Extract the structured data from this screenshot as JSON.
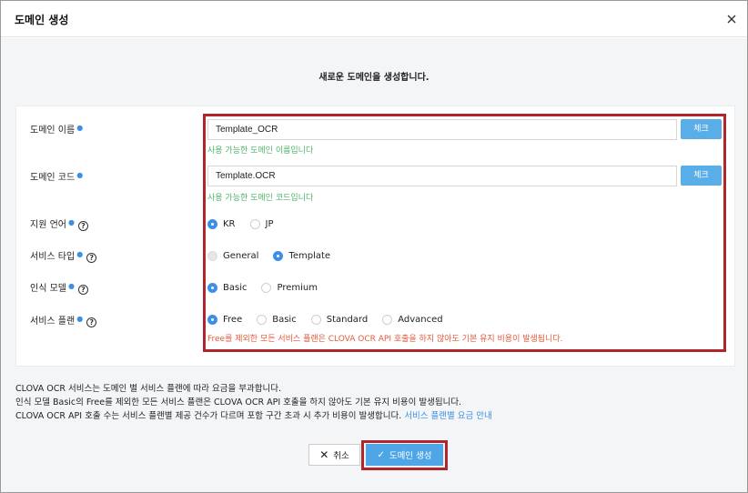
{
  "dialog": {
    "title": "도메인 생성",
    "subtitle": "새로운 도메인을 생성합니다."
  },
  "fields": {
    "domain_name": {
      "label": "도메인 이름",
      "value": "Template_OCR",
      "check_label": "체크",
      "message": "사용 가능한 도메인 이름입니다"
    },
    "domain_code": {
      "label": "도메인 코드",
      "value": "Template.OCR",
      "check_label": "체크",
      "message": "사용 가능한 도메인 코드입니다"
    },
    "language": {
      "label": "지원 언어",
      "options": [
        "KR",
        "JP"
      ],
      "selected": "KR"
    },
    "service_type": {
      "label": "서비스 타입",
      "options": [
        "General",
        "Template"
      ],
      "selected": "Template"
    },
    "recognition_model": {
      "label": "인식 모델",
      "options": [
        "Basic",
        "Premium"
      ],
      "selected": "Basic"
    },
    "service_plan": {
      "label": "서비스 플랜",
      "options": [
        "Free",
        "Basic",
        "Standard",
        "Advanced"
      ],
      "selected": "Free",
      "warning": "Free를 제외한 모든 서비스 플랜은 CLOVA OCR API 호출을 하지 않아도 기본 유지 비용이 발생됩니다."
    }
  },
  "notes": {
    "line1": "CLOVA OCR 서비스는 도메인 별 서비스 플랜에 따라 요금을 부과합니다.",
    "line2": "인식 모델 Basic의 Free를 제외한 모든 서비스 플랜은 CLOVA OCR API 호출을 하지 않아도 기본 유지 비용이 발생됩니다.",
    "line3": "CLOVA OCR API 호출 수는 서비스 플랜별 제공 건수가 다르며 포함 구간 초과 시 추가 비용이 발생합니다.",
    "link": "서비스 플랜별 요금 안내"
  },
  "buttons": {
    "cancel": "취소",
    "submit": "도메인 생성"
  },
  "colors": {
    "accent": "#3d8fe6",
    "button": "#5aaee8",
    "success": "#4db36a",
    "warning": "#e55a3a",
    "highlight": "#b0262c"
  }
}
